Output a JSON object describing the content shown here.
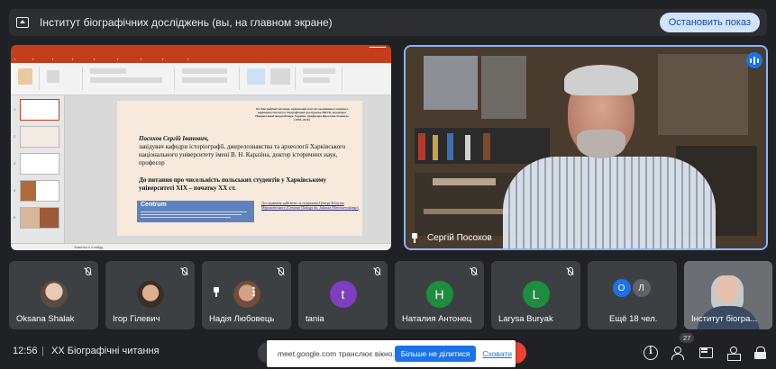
{
  "banner": {
    "title": "Інститут біографічних досліджень (вы, на главном экране)",
    "stop_presenting": "Остановить показ"
  },
  "slide": {
    "header_text": "XX Біографічні читання, присвячені пам'яті засновника і першого керівника Інституту біографічних досліджень НБУВ, академіка Національної академії наук України, професора Ярослава Ісаєвича (1936–2010)",
    "author_name": "Посохов Сергій Іванович,",
    "author_details": "завідувач кафедри історіографії, джерелознавства та археології Харківського національного університету імені В. Н. Каразіна, доктор історичних наук, професор",
    "topic": "До питання про чисельність польських студентів у Харківському університеті XIX – початку XX ст.",
    "centrum_name": "Centrum",
    "support_text": "Дослідження здійснено за підтримки Центру Юліуша Мерошевського (Centrum Dialogu im. Juliusza Mieroszewskiego)",
    "status_text": "Заметки к слайду"
  },
  "speaker": {
    "name": "Сергій Посохов"
  },
  "participants": [
    {
      "name": "Oksana Shalak",
      "type": "photo"
    },
    {
      "name": "Ігор Гілевич",
      "type": "photo"
    },
    {
      "name": "Надія Любовець",
      "type": "photo"
    },
    {
      "name": "tania",
      "type": "letter",
      "letter": "t",
      "color": "#7b3fbf"
    },
    {
      "name": "Наталия Антонец",
      "type": "letter",
      "letter": "Н",
      "color": "#1e8e3e"
    },
    {
      "name": "Larysa Buryak",
      "type": "letter",
      "letter": "L",
      "color": "#1e8e3e"
    },
    {
      "name": "Ещё 18 чел.",
      "type": "more",
      "letters": [
        "О",
        "Л"
      ]
    },
    {
      "name": "Інститут біогра...",
      "type": "self"
    }
  ],
  "bottom": {
    "time": "12:56",
    "separator": "|",
    "meeting_name": "XX Біографічні читання",
    "people_count": "27",
    "share_notice": {
      "message": "meet.google.com транслює вікно.",
      "stop_label": "Більше не ділитися",
      "hide_label": "Сховати"
    }
  },
  "colors": {
    "background": "#202124",
    "tile": "#3c4043",
    "accent": "#1a73e8",
    "speaker_border": "#8ab4f8"
  }
}
